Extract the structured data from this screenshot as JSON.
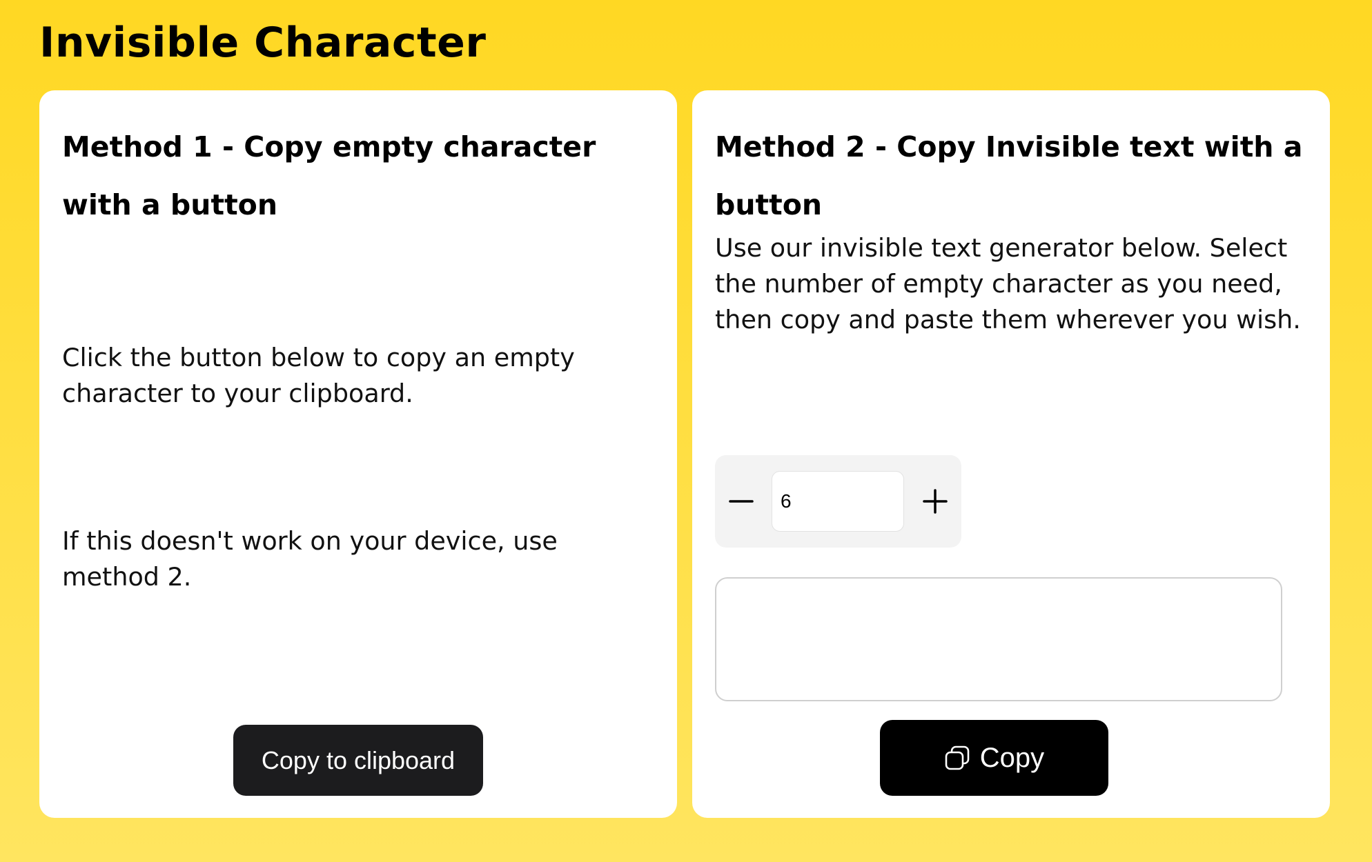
{
  "header": {
    "title": "Invisible Character"
  },
  "method1": {
    "heading": "Method 1 - Copy empty character with a button",
    "instruction": "Click the button below to copy an empty character to your clipboard.",
    "fallback_note": "If this doesn't work on your device, use method 2.",
    "button_label": "Copy to clipboard"
  },
  "method2": {
    "heading": "Method 2 - Copy Invisible text with a button",
    "description": "Use our invisible text generator below. Select the number of empty character as you need, then copy and paste them wherever you wish.",
    "stepper": {
      "value": "6",
      "minus_icon": "minus-icon",
      "plus_icon": "plus-icon"
    },
    "output_value": "",
    "copy_label": "Copy",
    "copy_icon": "copy-icon"
  },
  "colors": {
    "background_top": "#ffd823",
    "background_bottom": "#ffe560",
    "card": "#ffffff",
    "primary_button": "#000000",
    "secondary_button": "#1c1c1e",
    "stepper_bg": "#f3f3f3"
  }
}
